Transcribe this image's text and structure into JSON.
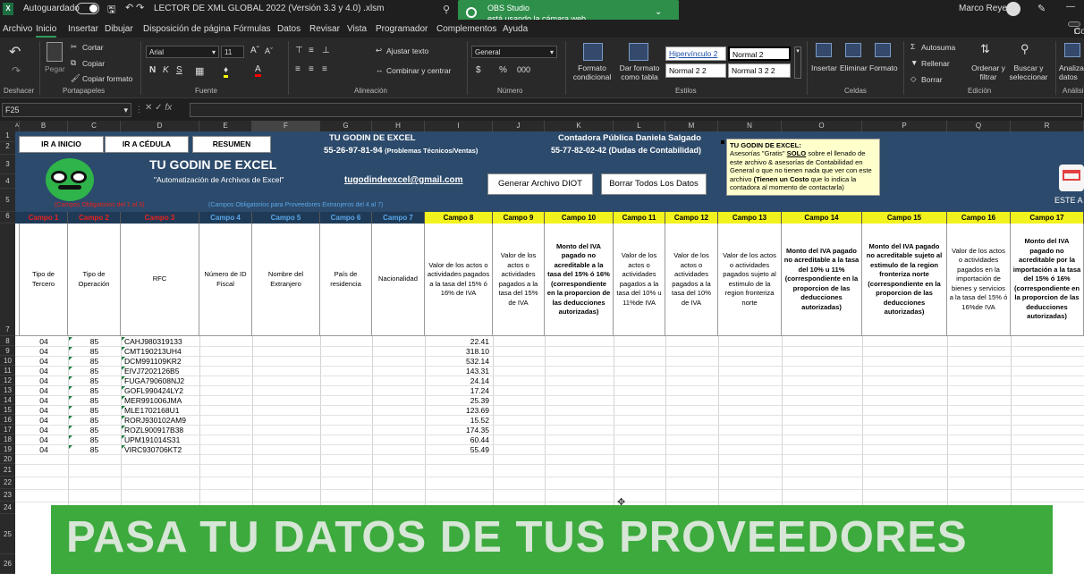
{
  "titlebar": {
    "autosave": "Autoguardado",
    "filename": "LECTOR DE XML GLOBAL 2022 (Versión 3.3 y 4.0) .xlsm",
    "user": "Marco Reyes"
  },
  "toast": {
    "app": "OBS Studio",
    "message": "está usando la cámara web"
  },
  "menu": [
    "Archivo",
    "Inicio",
    "Insertar",
    "Dibujar",
    "Disposición de página",
    "Fórmulas",
    "Datos",
    "Revisar",
    "Vista",
    "Programador",
    "Complementos",
    "Ayuda"
  ],
  "comments_label": "Comentarios",
  "ribbon": {
    "undo": "Deshacer",
    "paste": "Pegar",
    "cut": "Cortar",
    "copy": "Copiar",
    "format_painter": "Copiar formato",
    "clipboard": "Portapapeles",
    "font_name": "Arial",
    "font_size": "11",
    "font_group": "Fuente",
    "wrap": "Ajustar texto",
    "merge": "Combinar y centrar",
    "alignment": "Alineación",
    "number_format": "General",
    "number": "Número",
    "cond_format": "Formato condicional",
    "format_table": "Dar formato como tabla",
    "style1": "Hipervínculo 2",
    "style2": "Normal 2",
    "style3": "Normal 2 2",
    "style4": "Normal 3 2 2",
    "styles": "Estilos",
    "insert": "Insertar",
    "delete": "Eliminar",
    "format": "Formato",
    "cells": "Celdas",
    "autosum": "Autosuma",
    "fill": "Rellenar",
    "clear": "Borrar",
    "sort": "Ordenar y filtrar",
    "find": "Buscar y seleccionar",
    "editing": "Edición",
    "analyze": "Analizar datos",
    "analysis": "Análisis"
  },
  "formula_bar": {
    "name_box": "F25",
    "fx": "fx"
  },
  "columns": [
    "A",
    "B",
    "C",
    "D",
    "E",
    "F",
    "G",
    "H",
    "I",
    "J",
    "K",
    "L",
    "M",
    "N",
    "O",
    "P",
    "Q",
    "R"
  ],
  "rows": [
    "1",
    "2",
    "3",
    "4",
    "5",
    "6",
    "7",
    "8",
    "9",
    "10",
    "11",
    "12",
    "13",
    "14",
    "15",
    "16",
    "17",
    "18",
    "19",
    "20",
    "21",
    "22",
    "23",
    "24",
    "25",
    "26"
  ],
  "banner": {
    "btn_inicio": "IR A INICIO",
    "btn_cedula": "IR A CÉDULA",
    "btn_resumen": "RESUMEN",
    "title": "TU GODIN DE EXCEL",
    "subtitle": "\"Automatización de Archivos de Excel\"",
    "header1": "TU GODIN DE EXCEL",
    "phone1": "55-26-97-81-94",
    "phone1_note": "(Problemas Técnicos/Ventas)",
    "header2": "Contadora Pública Daniela Salgado",
    "phone2": "55-77-82-02-42 (Dudas de Contabilidad)",
    "email": "tugodindeexcel@gmail.com",
    "btn_diot": "Generar Archivo DIOT",
    "btn_borrar": "Borrar Todos Los Datos",
    "note_title": "TU GODIN DE EXCEL:",
    "note_body_1": "Asesorías \"Gratis\"",
    "note_solo": "SOLO",
    "note_body_2": "sobre el llenado de este archivo & asesorías de Contabilidad en General o que no tienen nada que ver con este archivo",
    "note_cost": "(Tienen un Costo",
    "note_body_3": "que lo indica la contadora al momento de contactarla)",
    "req_red": "(Campos Obligatorios del 1 al 3)",
    "req_blue": "(Campos Obligatorios para Proveedores Extranjeros del 4 al 7)",
    "corner": "ESTE A"
  },
  "fields": [
    "Campo 1",
    "Campo 2",
    "Campo 3",
    "Campo 4",
    "Campo 5",
    "Campo 6",
    "Campo 7",
    "Campo 8",
    "Campo 9",
    "Campo 10",
    "Campo 11",
    "Campo 12",
    "Campo 13",
    "Campo 14",
    "Campo 15",
    "Campo 16",
    "Campo 17"
  ],
  "field_colors": {
    "red": "#e8231f",
    "blue": "#5aa7e8",
    "yellow": "#e8e81f"
  },
  "descriptions": [
    "Tipo de Tercero",
    "Tipo de Operación",
    "RFC",
    "Número de ID Fiscal",
    "Nombre del Extranjero",
    "País de residencia",
    "Nacionalidad",
    "Valor de los actos o actividades pagados a la tasa del 15% ó 16% de IVA",
    "Valor de los actos o actividades pagados a la tasa del 15% de IVA",
    "Monto del IVA pagado no acreditable a la tasa del 15% ó 16% (correspondiente en la proporcion de las deducciones autorizadas)",
    "Valor de los actos o actividades pagados a la tasa del 10% u 11%de IVA",
    "Valor de los actos o actividades pagados a la tasa del 10% de IVA",
    "Valor de los actos o actividades pagados sujeto al estimulo de la region fronteriza norte",
    "Monto del IVA pagado no acreditable a la tasa del 10% u 11% (correspondiente en la proporcion de las deducciones autorizadas)",
    "Monto del IVA pagado no acreditable sujeto al estimulo de la region fronteriza norte (correspondiente en la proporcion de las deducciones autorizadas)",
    "Valor de los actos o actividades pagados en la importación de bienes y servicios a la tasa del 15% ó 16%de IVA",
    "Monto del IVA pagado no acreditable por la importación a la tasa del 15% ó 16% (correspondiente en la proporcion de las deducciones autorizadas)"
  ],
  "records": [
    {
      "tercero": "04",
      "operacion": "85",
      "rfc": "CAHJ980319133",
      "valor": "22.41"
    },
    {
      "tercero": "04",
      "operacion": "85",
      "rfc": "CMT190213UH4",
      "valor": "318.10"
    },
    {
      "tercero": "04",
      "operacion": "85",
      "rfc": "DCM991109KR2",
      "valor": "532.14"
    },
    {
      "tercero": "04",
      "operacion": "85",
      "rfc": "EIVJ7202126B5",
      "valor": "143.31"
    },
    {
      "tercero": "04",
      "operacion": "85",
      "rfc": "FUGA790608NJ2",
      "valor": "24.14"
    },
    {
      "tercero": "04",
      "operacion": "85",
      "rfc": "GOFL990424LY2",
      "valor": "17.24"
    },
    {
      "tercero": "04",
      "operacion": "85",
      "rfc": "MER991006JMA",
      "valor": "25.39"
    },
    {
      "tercero": "04",
      "operacion": "85",
      "rfc": "MLE1702168U1",
      "valor": "123.69"
    },
    {
      "tercero": "04",
      "operacion": "85",
      "rfc": "RORJ930102AM9",
      "valor": "15.52"
    },
    {
      "tercero": "04",
      "operacion": "85",
      "rfc": "ROZL900917B38",
      "valor": "174.35"
    },
    {
      "tercero": "04",
      "operacion": "85",
      "rfc": "UPM191014S31",
      "valor": "60.44"
    },
    {
      "tercero": "04",
      "operacion": "85",
      "rfc": "VIRC930706KT2",
      "valor": "55.49"
    }
  ],
  "overlay_text": "PASA TU DATOS DE TUS PROVEEDORES"
}
